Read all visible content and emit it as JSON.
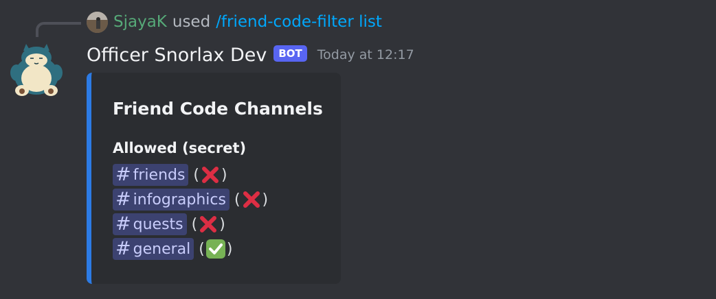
{
  "reply": {
    "username": "SjayaK",
    "action": "used",
    "command": "/friend-code-filter list"
  },
  "message": {
    "author": "Officer Snorlax Dev",
    "badge": "BOT",
    "timestamp": "Today at 12:17"
  },
  "embed": {
    "accent_color": "#2c7be5",
    "title": "Friend Code Channels",
    "field_name": "Allowed (secret)",
    "channels": [
      {
        "name": "friends",
        "status": "cross-mark-icon"
      },
      {
        "name": "infographics",
        "status": "cross-mark-icon"
      },
      {
        "name": "quests",
        "status": "cross-mark-icon"
      },
      {
        "name": "general",
        "status": "check-mark-icon"
      }
    ]
  },
  "colors": {
    "background": "#313338",
    "embed_background": "#2b2d31",
    "mention_background": "#3c4270",
    "bot_badge": "#5865f2",
    "reply_username": "#56a978",
    "command_link": "#00a8fc"
  }
}
